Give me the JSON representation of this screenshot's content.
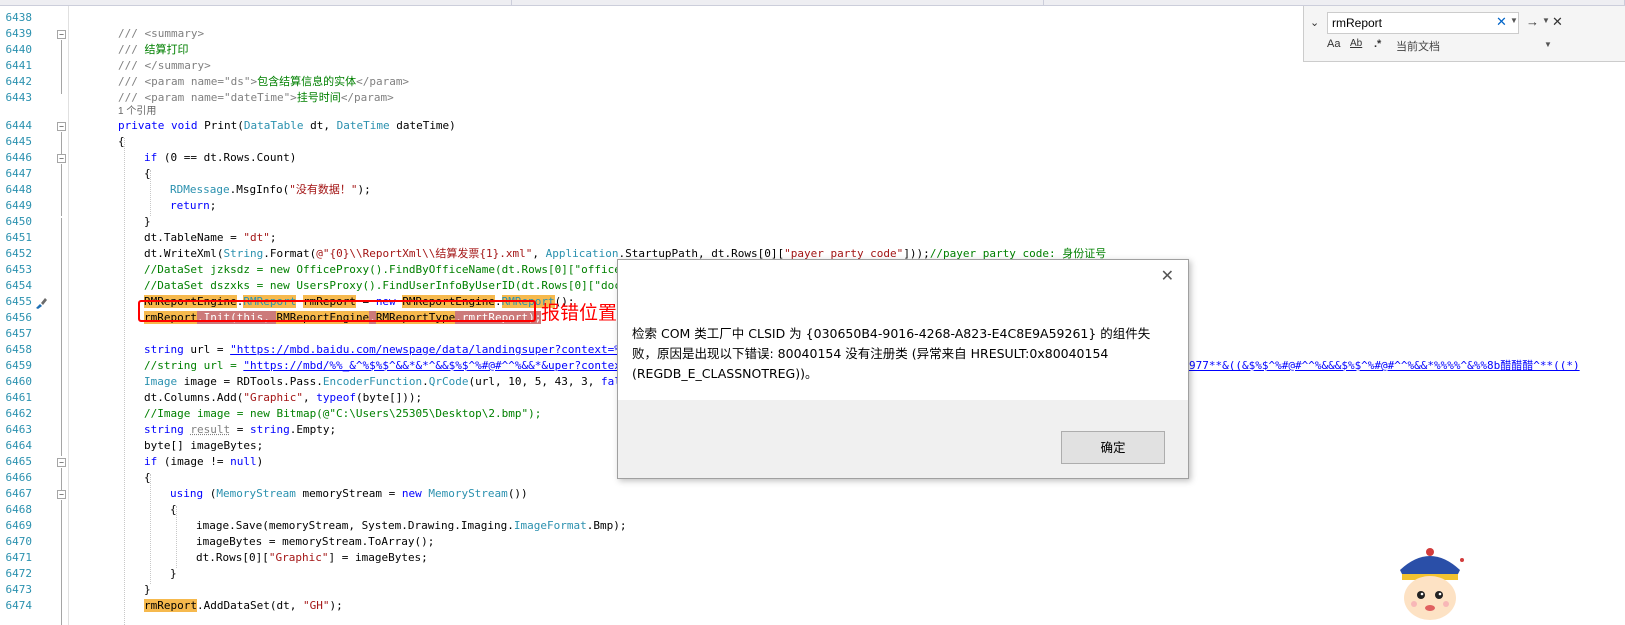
{
  "editor": {
    "line_numbers": [
      "6438",
      "6439",
      "6440",
      "6441",
      "6442",
      "6443",
      "6444",
      "6445",
      "6446",
      "6447",
      "6448",
      "6449",
      "6450",
      "6451",
      "6452",
      "6453",
      "6454",
      "6455",
      "6456",
      "6457",
      "6458",
      "6459",
      "6460",
      "6461",
      "6462",
      "6463",
      "6464",
      "6465",
      "6466",
      "6467",
      "6468",
      "6469",
      "6470",
      "6471",
      "6472",
      "6473",
      "6474"
    ],
    "code": {
      "summary_open": "/// <summary>",
      "summary_text_prefix": "/// ",
      "summary_text": "结算打印",
      "summary_close": "/// </summary>",
      "param_ds_open": "/// <param name=\"ds\">",
      "param_ds_text": "包含结算信息的实体",
      "param_close": "</param>",
      "param_dt_open": "/// <param name=\"dateTime\">",
      "param_dt_text": "挂号时间",
      "references": "1 个引用",
      "l6444_private": "private",
      "l6444_void": "void",
      "l6444_name": "Print(",
      "l6444_type1": "DataTable",
      "l6444_mid": " dt, ",
      "l6444_type2": "DateTime",
      "l6444_end": " dateTime)",
      "brace_open": "{",
      "brace_close": "}",
      "l6446_if": "if",
      "l6446_rest": " (0 == dt.Rows.Count)",
      "l6448_type": "RDMessage",
      "l6448_mid": ".MsgInfo(",
      "l6448_str": "\"没有数据！\"",
      "l6448_end": ");",
      "l6449_return": "return",
      "semicolon": ";",
      "l6451_a": "dt.TableName = ",
      "l6451_str": "\"dt\"",
      "l6452_a": "dt.WriteXml(",
      "l6452_type": "String",
      "l6452_b": ".Format(",
      "l6452_str": "@\"{0}\\\\ReportXml\\\\结算发票{1}.xml\"",
      "l6452_c": ", ",
      "l6452_type2": "Application",
      "l6452_d": ".StartupPath, dt.Rows[0][",
      "l6452_str2": "\"payer_party_code\"",
      "l6452_e": "]));",
      "l6452_comment": "//payer_party_code: 身份证号",
      "l6453": "//DataSet jzksdz = new OfficeProxy().FindByOfficeName(dt.Rows[0][\"office\"].",
      "l6454": "//DataSet dszxks = new UsersProxy().FindUserInfoByUserID(dt.Rows[0][\"doctor",
      "l6455_a": "RMReportEngine",
      "l6455_b": ".",
      "l6455_c": "RMReport",
      "l6455_d": " ",
      "l6455_e": "rmReport",
      "l6455_f": " = ",
      "l6455_new": "new",
      "l6455_g": " ",
      "l6455_h": "RMReportEngine",
      "l6455_i": ".",
      "l6455_j": "RMReport",
      "l6455_k": "();",
      "l6456_a": "rmReport",
      "l6456_b": ".Init(this, ",
      "l6456_c": "RMReportEngine",
      "l6456_d": ".",
      "l6456_e": "RMReport",
      "l6456_f": "Type",
      "l6456_g": ".rmrtReport);",
      "l6458_string": "string",
      "l6458_a": " url = ",
      "l6458_url": "\"https://mbd.baidu.com/newspage/data/landingsuper?context=%7B%",
      "l6459_a": "//string url = ",
      "l6459_url": "\"https://mbd/%%_&^%$%$^&&*&*^&&$%$^%#@#^^%&&*&uper?context=%",
      "l6459_tail": "977**&((&$%$^%#@#^^%&&&$%$^%#@#^^%&&*%%%%^&%%8b醋醋醋^**((*)",
      "l6460_type": "Image",
      "l6460_a": " image = RDTools.Pass.",
      "l6460_type2": "EncoderFunction",
      "l6460_b": ".",
      "l6460_type3": "QrCode",
      "l6460_c": "(url, 10, 5, 43, 3, ",
      "l6460_false": "false",
      "l6460_d": ")",
      "l6461_a": "dt.Columns.Add(",
      "l6461_str": "\"Graphic\"",
      "l6461_b": ", ",
      "l6461_typeof": "typeof",
      "l6461_c": "(byte[]));",
      "l6462_a": "//Image image = new Bitmap(@\"C:\\Users\\25305\\Desktop\\2.bmp\");",
      "l6463_string": "string",
      "l6463_a": " ",
      "l6463_result": "result",
      "l6463_b": " = ",
      "l6463_string2": "string",
      "l6463_c": ".Empty;",
      "l6464_a": "byte[] imageBytes;",
      "l6465_if": "if",
      "l6465_a": " (image != ",
      "l6465_null": "null",
      "l6465_b": ")",
      "l6467_using": "using",
      "l6467_a": " (",
      "l6467_type": "MemoryStream",
      "l6467_b": " memoryStream = ",
      "l6467_new": "new",
      "l6467_c": " ",
      "l6467_type2": "MemoryStream",
      "l6467_d": "())",
      "l6469_a": "image.Save(memoryStream, System.Drawing.Imaging.",
      "l6469_type": "ImageFormat",
      "l6469_b": ".Bmp);",
      "l6470_a": "imageBytes = memoryStream.ToArray();",
      "l6471_a": "dt.Rows[0][",
      "l6471_str": "\"Graphic\"",
      "l6471_b": "] = imageBytes;",
      "l6474_a": "rmReport",
      "l6474_b": ".AddDataSet(dt, ",
      "l6474_str": "\"GH\"",
      "l6474_c": ");"
    }
  },
  "annotation": {
    "label": "报错位置"
  },
  "find_widget": {
    "search_value": "rmReport",
    "clear_icon_glyph": "✕",
    "next_icon_glyph": "→",
    "close_icon_glyph": "✕",
    "match_case_label": "Aa",
    "whole_word_label": "Ab",
    "regex_label": ".*",
    "scope_value": "当前文档"
  },
  "dialog": {
    "message": "检索 COM 类工厂中 CLSID 为 {030650B4-9016-4268-A823-E4C8E9A59261} 的组件失败，原因是出现以下错误: 80040154 没有注册类 (异常来自 HRESULT:0x80040154 (REGDB_E_CLASSNOTREG))。",
    "ok_label": "确定",
    "close_glyph": "✕"
  },
  "colors": {
    "comment": "#008000",
    "keyword": "#0000ff",
    "type": "#2b91af",
    "string": "#a31515",
    "highlight": "#f6b94d",
    "error_box": "#ff0000"
  }
}
